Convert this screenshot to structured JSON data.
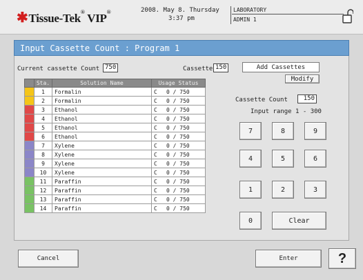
{
  "header": {
    "brand": "Tissue-Tek",
    "product": "VIP",
    "date": "2008. May 8. Thursday",
    "time": "3:37 pm",
    "location": "LABORATORY",
    "user": "ADMIN 1",
    "lock_icon": "padlock-open-icon"
  },
  "title": "Input Cassette Count : Program 1",
  "counts": {
    "current_label": "Current cassette Count",
    "current_value": "750",
    "cassettes_label": "Cassettes",
    "cassettes_value": "150"
  },
  "table": {
    "headers": [
      "Sta.",
      "Solution Name",
      "Usage Status"
    ],
    "rows": [
      {
        "sta": "1",
        "name": "Formalin",
        "flag": "C",
        "usage": "0 / 750",
        "color": "#f5c518"
      },
      {
        "sta": "2",
        "name": "Formalin",
        "flag": "C",
        "usage": "0 / 750",
        "color": "#f5c518"
      },
      {
        "sta": "3",
        "name": "Ethanol",
        "flag": "C",
        "usage": "0 / 750",
        "color": "#e04848"
      },
      {
        "sta": "4",
        "name": "Ethanol",
        "flag": "C",
        "usage": "0 / 750",
        "color": "#e04848"
      },
      {
        "sta": "5",
        "name": "Ethanol",
        "flag": "C",
        "usage": "0 / 750",
        "color": "#e04848"
      },
      {
        "sta": "6",
        "name": "Ethanol",
        "flag": "C",
        "usage": "0 / 750",
        "color": "#e04848"
      },
      {
        "sta": "7",
        "name": "Xylene",
        "flag": "C",
        "usage": "0 / 750",
        "color": "#8b86c8"
      },
      {
        "sta": "8",
        "name": "Xylene",
        "flag": "C",
        "usage": "0 / 750",
        "color": "#8b86c8"
      },
      {
        "sta": "9",
        "name": "Xylene",
        "flag": "C",
        "usage": "0 / 750",
        "color": "#8b86c8"
      },
      {
        "sta": "10",
        "name": "Xylene",
        "flag": "C",
        "usage": "0 / 750",
        "color": "#8b86c8"
      },
      {
        "sta": "11",
        "name": "Paraffin",
        "flag": "C",
        "usage": "0 / 750",
        "color": "#79c264"
      },
      {
        "sta": "12",
        "name": "Paraffin",
        "flag": "C",
        "usage": "0 / 750",
        "color": "#79c264"
      },
      {
        "sta": "13",
        "name": "Paraffin",
        "flag": "C",
        "usage": "0 / 750",
        "color": "#79c264"
      },
      {
        "sta": "14",
        "name": "Paraffin",
        "flag": "C",
        "usage": "0 / 750",
        "color": "#79c264"
      }
    ]
  },
  "side": {
    "add_cassettes": "Add Cassettes",
    "modify": "Modify",
    "cassette_count_label": "Cassette Count",
    "cassette_count_value": "150",
    "range": "Input range 1 - 300"
  },
  "keypad": {
    "k7": "7",
    "k8": "8",
    "k9": "9",
    "k4": "4",
    "k5": "5",
    "k6": "6",
    "k1": "1",
    "k2": "2",
    "k3": "3",
    "k0": "0",
    "clear": "Clear"
  },
  "footer": {
    "cancel": "Cancel",
    "enter": "Enter",
    "help": "?"
  }
}
